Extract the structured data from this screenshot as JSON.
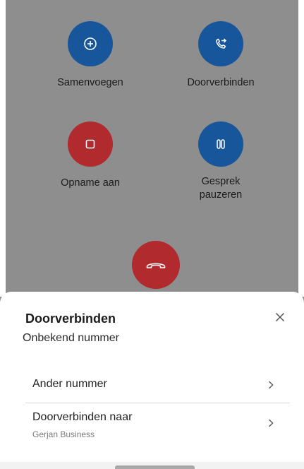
{
  "actions": {
    "merge_label": "Samenvoegen",
    "transfer_label": "Doorverbinden",
    "record_label": "Opname aan",
    "hold_label_line1": "Gesprek",
    "hold_label_line2": "pauzeren"
  },
  "sheet": {
    "title": "Doorverbinden",
    "subtitle": "Onbekend nummer",
    "options": [
      {
        "label": "Ander nummer"
      },
      {
        "label": "Doorverbinden naar",
        "sublabel": "Gerjan Business"
      }
    ]
  },
  "colors": {
    "action_blue": "#17569a",
    "action_red": "#b02a2e",
    "overlay_gray": "#8e8e8e"
  },
  "icons": {
    "merge": "add-circle-icon",
    "transfer": "call-transfer-icon",
    "record": "record-stop-icon",
    "hold": "pause-icon",
    "end_call": "hang-up-icon",
    "close": "close-icon",
    "chevron": "chevron-right-icon"
  }
}
